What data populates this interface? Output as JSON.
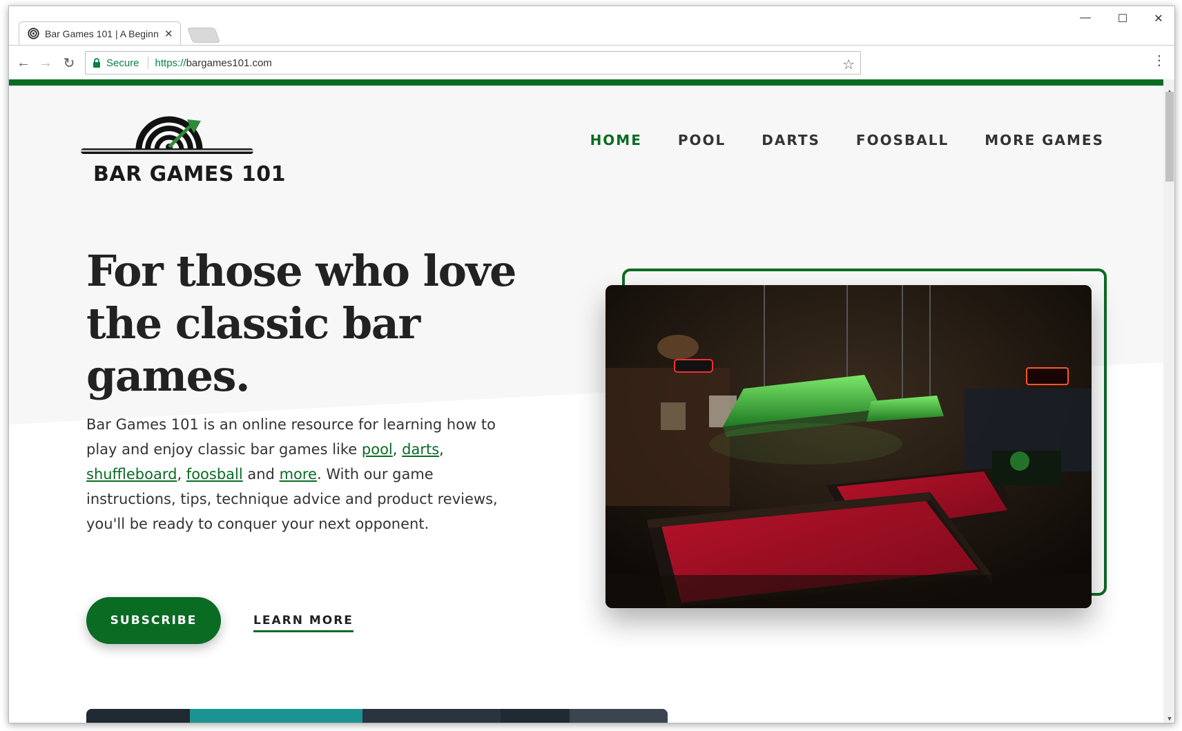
{
  "browser": {
    "tab_title": "Bar Games 101 | A Beginn",
    "tab_close": "✕",
    "window_minimize": "—",
    "window_maximize": "☐",
    "window_close": "✕",
    "back": "←",
    "forward": "→",
    "reload": "↻",
    "secure_label": "Secure",
    "url_scheme": "https://",
    "url_host": "bargames101.com",
    "bookmark_star": "☆",
    "menu_dots": "⋮"
  },
  "site": {
    "logo_text": "BAR GAMES 101",
    "nav": [
      {
        "label": "HOME",
        "active": true
      },
      {
        "label": "POOL"
      },
      {
        "label": "DARTS"
      },
      {
        "label": "FOOSBALL"
      },
      {
        "label": "MORE GAMES"
      }
    ],
    "hero": {
      "title": "For those who love the classic bar games.",
      "body_1": "Bar Games 101 is an online resource for learning how to play and enjoy classic bar games like ",
      "link_pool": "pool",
      "sep_1": ", ",
      "link_darts": "darts",
      "sep_2": ", ",
      "link_shuffleboard": "shuffleboard",
      "sep_3": ", ",
      "link_foosball": "foosball",
      "sep_4": " and ",
      "link_more": "more",
      "body_2": ". With our game instructions, tips, technique advice and product reviews, you'll be ready to conquer your next opponent.",
      "subscribe_label": "SUBSCRIBE",
      "learn_more_label": "LEARN MORE"
    }
  },
  "colors": {
    "brand_green": "#0a6b23",
    "secure_green": "#0b8043"
  },
  "icons": [
    "target-favicon-icon",
    "lock-icon",
    "star-icon",
    "menu-icon",
    "back-arrow-icon",
    "forward-arrow-icon",
    "reload-icon"
  ]
}
